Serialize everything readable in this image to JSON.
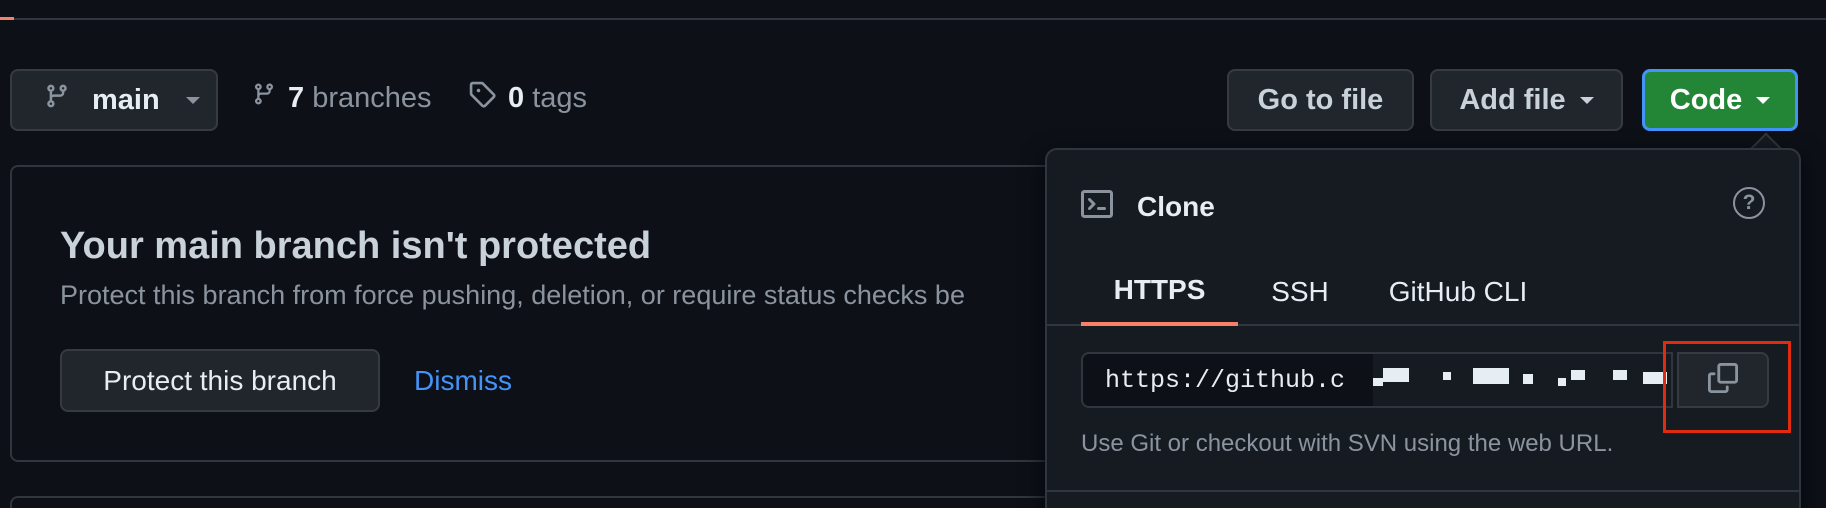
{
  "branch_bar": {
    "current_branch": "main",
    "branch_count": "7",
    "branches_label": "branches",
    "tag_count": "0",
    "tags_label": "tags"
  },
  "actions": {
    "go_to_file": "Go to file",
    "add_file": "Add file",
    "code": "Code"
  },
  "protection_banner": {
    "title": "Your main branch isn't protected",
    "description": "Protect this branch from force pushing, deletion, or require status checks be",
    "protect_button": "Protect this branch",
    "dismiss_link": "Dismiss"
  },
  "clone_panel": {
    "title": "Clone",
    "tabs": [
      {
        "label": "HTTPS",
        "active": true
      },
      {
        "label": "SSH",
        "active": false
      },
      {
        "label": "GitHub CLI",
        "active": false
      }
    ],
    "url_visible": "https://github.c",
    "hint": "Use Git or checkout with SVN using the web URL."
  },
  "colors": {
    "background": "#0d1117",
    "code_button": "#238636",
    "focus_ring": "#4493f8",
    "active_tab_underline": "#f78166",
    "link": "#4493f8",
    "highlight_box": "#e02b10"
  },
  "icons": [
    "git-branch-icon",
    "tag-icon",
    "terminal-icon",
    "question-circle-icon",
    "copy-icon"
  ]
}
